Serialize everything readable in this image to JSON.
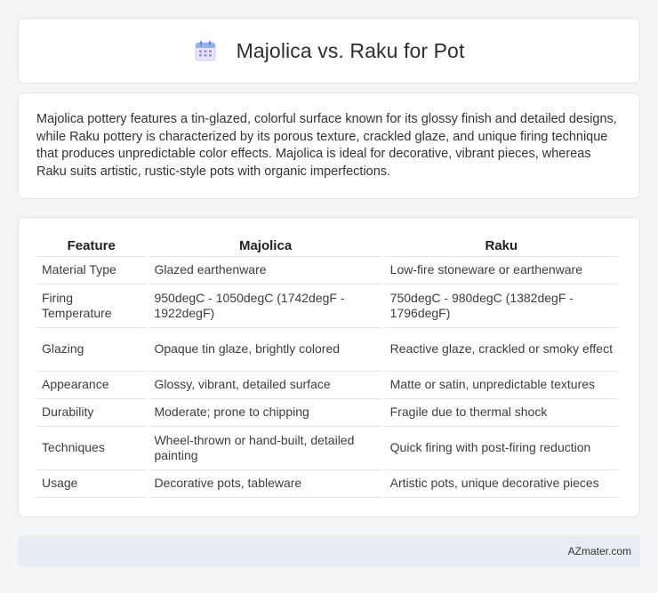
{
  "header": {
    "icon": "calendar-icon",
    "title": "Majolica vs. Raku for Pot"
  },
  "intro": {
    "text": "Majolica pottery features a tin-glazed, colorful surface known for its glossy finish and detailed designs, while Raku pottery is characterized by its porous texture, crackled glaze, and unique firing technique that produces unpredictable color effects. Majolica is ideal for decorative, vibrant pieces, whereas Raku suits artistic, rustic-style pots with organic imperfections."
  },
  "table": {
    "headers": [
      "Feature",
      "Majolica",
      "Raku"
    ],
    "rows": [
      [
        "Material Type",
        "Glazed earthenware",
        "Low-fire stoneware or earthenware"
      ],
      [
        "Firing Temperature",
        "950degC - 1050degC (1742degF - 1922degF)",
        "750degC - 980degC (1382degF - 1796degF)"
      ],
      [
        "Glazing",
        "Opaque tin glaze, brightly colored",
        "Reactive glaze, crackled or smoky effect"
      ],
      [
        "Appearance",
        "Glossy, vibrant, detailed surface",
        "Matte or satin, unpredictable textures"
      ],
      [
        "Durability",
        "Moderate; prone to chipping",
        "Fragile due to thermal shock"
      ],
      [
        "Techniques",
        "Wheel-thrown or hand-built, detailed painting",
        "Quick firing with post-firing reduction"
      ],
      [
        "Usage",
        "Decorative pots, tableware",
        "Artistic pots, unique decorative pieces"
      ]
    ]
  },
  "footer": {
    "text": "AZmater.com"
  },
  "colors": {
    "background": "#f3f4f6",
    "card": "#ffffff",
    "footer": "#e8ecf5",
    "icon_accent": "#8b7bd8"
  }
}
